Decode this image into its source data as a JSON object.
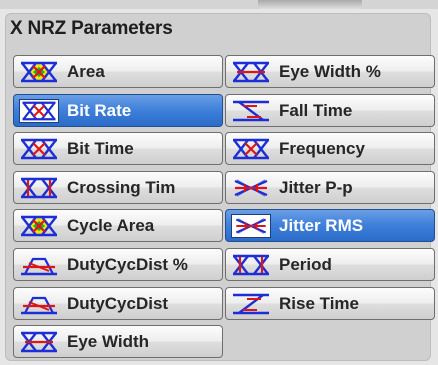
{
  "panel": {
    "title": "X NRZ Parameters"
  },
  "colors": {
    "selected_bg": "#3d7fd9",
    "icon_blue": "#1c2fd6",
    "icon_red": "#e01414",
    "icon_yellow": "#f2e400",
    "icon_green": "#0fb03c"
  },
  "buttons": [
    {
      "id": "area",
      "label": "Area",
      "icon": "eye-filled-yellow-green-icon",
      "selected": false
    },
    {
      "id": "eye-width-pct",
      "label": "Eye Width %",
      "icon": "eye-diagram-width-icon",
      "selected": false
    },
    {
      "id": "bit-rate",
      "label": "Bit Rate",
      "icon": "eye-diagram-bitrate-icon",
      "selected": true
    },
    {
      "id": "fall-time",
      "label": "Fall Time",
      "icon": "falling-edge-icon",
      "selected": false
    },
    {
      "id": "bit-time",
      "label": "Bit Time",
      "icon": "eye-diagram-bittime-icon",
      "selected": false
    },
    {
      "id": "frequency",
      "label": "Frequency",
      "icon": "eye-diagram-frequency-icon",
      "selected": false
    },
    {
      "id": "crossing-time",
      "label": "Crossing Tim",
      "icon": "eye-crossing-icon",
      "selected": false
    },
    {
      "id": "jitter-pp",
      "label": "Jitter P-p",
      "icon": "jitter-crossing-icon",
      "selected": false
    },
    {
      "id": "cycle-area",
      "label": "Cycle Area",
      "icon": "eye-filled-yellow-green-icon",
      "selected": false
    },
    {
      "id": "jitter-rms",
      "label": "Jitter RMS",
      "icon": "jitter-crossing-icon",
      "selected": true
    },
    {
      "id": "dutycycdist-pct",
      "label": "DutyCycDist %",
      "icon": "duty-cycle-distortion-icon",
      "selected": false
    },
    {
      "id": "period",
      "label": "Period",
      "icon": "eye-diagram-period-icon",
      "selected": false
    },
    {
      "id": "dutycycdist",
      "label": "DutyCycDist",
      "icon": "duty-cycle-distortion-icon",
      "selected": false
    },
    {
      "id": "rise-time",
      "label": "Rise Time",
      "icon": "rising-edge-icon",
      "selected": false
    },
    {
      "id": "eye-width",
      "label": "Eye Width",
      "icon": "eye-diagram-width-icon",
      "selected": false
    }
  ]
}
